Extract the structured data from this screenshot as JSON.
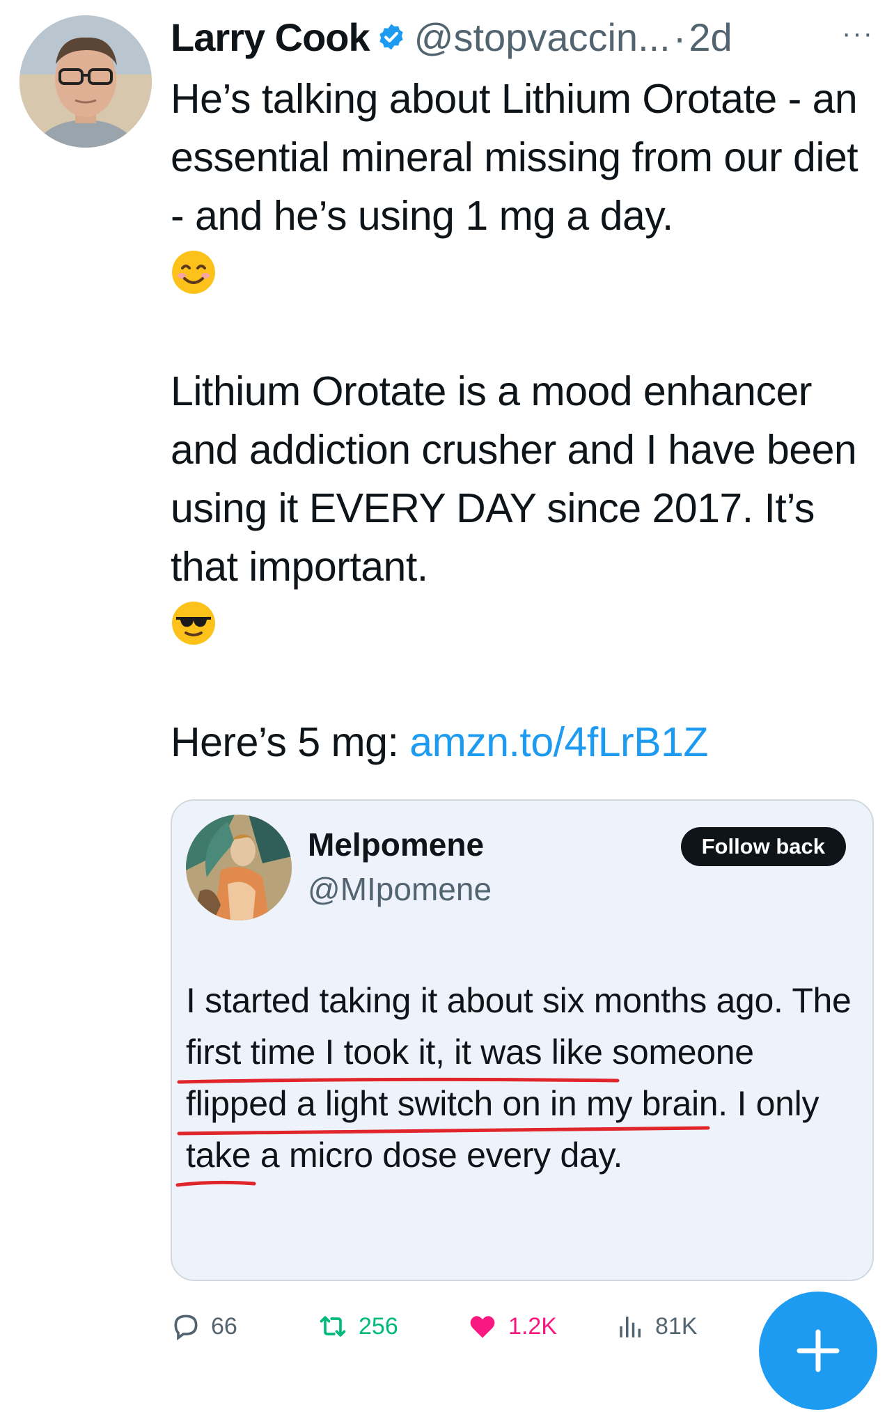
{
  "tweet": {
    "author_name": "Larry Cook",
    "author_handle": "@stopvaccin...",
    "separator": "·",
    "time": "2d",
    "more_label": "···",
    "line1": "He’s talking about Lithium Orotate - an essential mineral missing from our diet - and he’s using 1 mg a day.",
    "line2": "Lithium Orotate is a mood enhancer and addiction crusher and I have been using it EVERY DAY since 2017. It’s that important.",
    "line3_prefix": "Here’s 5 mg: ",
    "link": "amzn.to/4fLrB1Z",
    "emoji_1": "smiling-face-emoji",
    "emoji_2": "sunglasses-face-emoji"
  },
  "quote": {
    "author_name": "Melpomene",
    "author_handle": "@MIpomene",
    "follow_label": "Follow back",
    "text_part1": "I started taking it about six months ago. ",
    "text_underlined": "The first time I took it, it was like someone flipped a light switch on in my brain.",
    "text_part2": " I only take a micro dose every day."
  },
  "actions": {
    "replies": "66",
    "retweets": "256",
    "likes": "1.2K",
    "views": "81K"
  },
  "fab_icon": "plus-icon",
  "colors": {
    "link": "#1d9bf0",
    "retweet": "#00ba7c",
    "like": "#f91880",
    "underline": "#e0262b",
    "fab": "#1d9bf0"
  }
}
